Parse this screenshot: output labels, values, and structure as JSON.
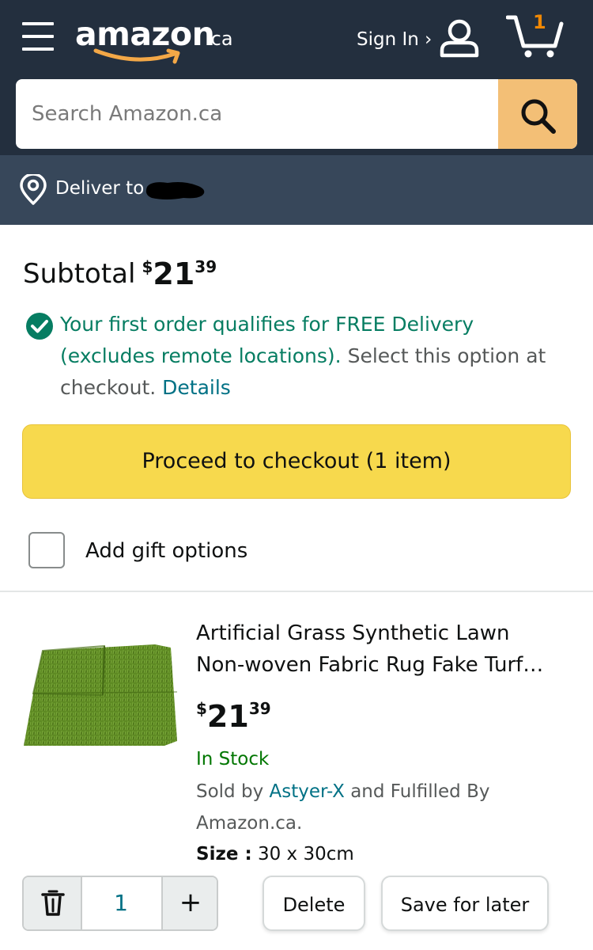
{
  "header": {
    "logo_text": "amazon",
    "logo_tld": ".ca",
    "sign_in_label": "Sign In ›",
    "cart_count": "1"
  },
  "search": {
    "placeholder": "Search Amazon.ca",
    "value": ""
  },
  "delivery": {
    "label": "Deliver to"
  },
  "subtotal": {
    "label": "Subtotal",
    "currency_symbol": "$",
    "whole": "21",
    "fraction": "39"
  },
  "free_delivery": {
    "green_text": "Your first order qualifies for FREE Delivery (excludes remote locations).",
    "gray_text": " Select this option at checkout. ",
    "details_link": "Details"
  },
  "checkout_button": {
    "label": "Proceed to checkout (1 item)"
  },
  "gift": {
    "label": "Add gift options",
    "checked": false
  },
  "item": {
    "title_line1": "Artificial Grass Synthetic Lawn",
    "title_line2": "Non-woven Fabric Rug Fake Turf…",
    "price_symbol": "$",
    "price_whole": "21",
    "price_fraction": "39",
    "stock": "In Stock",
    "sold_by_prefix": "Sold by ",
    "seller": "Astyer-X",
    "sold_by_suffix": " and Fulfilled By Amazon.ca.",
    "size_label": "Size :",
    "size_value": " 30 x 30cm",
    "quantity": "1",
    "plus_label": "+",
    "delete_label": "Delete",
    "save_later_label": "Save for later"
  },
  "colors": {
    "header_bg": "#232f3e",
    "deliver_bg": "#37475a",
    "search_button": "#f3bf76",
    "checkout_button": "#f7d94d",
    "green_text": "#067d62",
    "link": "#007185",
    "in_stock": "#007600",
    "cart_badge": "#f08804"
  },
  "icons": [
    "menu-icon",
    "account-icon",
    "cart-icon",
    "search-icon",
    "location-pin-icon",
    "check-circle-icon",
    "trash-icon"
  ]
}
